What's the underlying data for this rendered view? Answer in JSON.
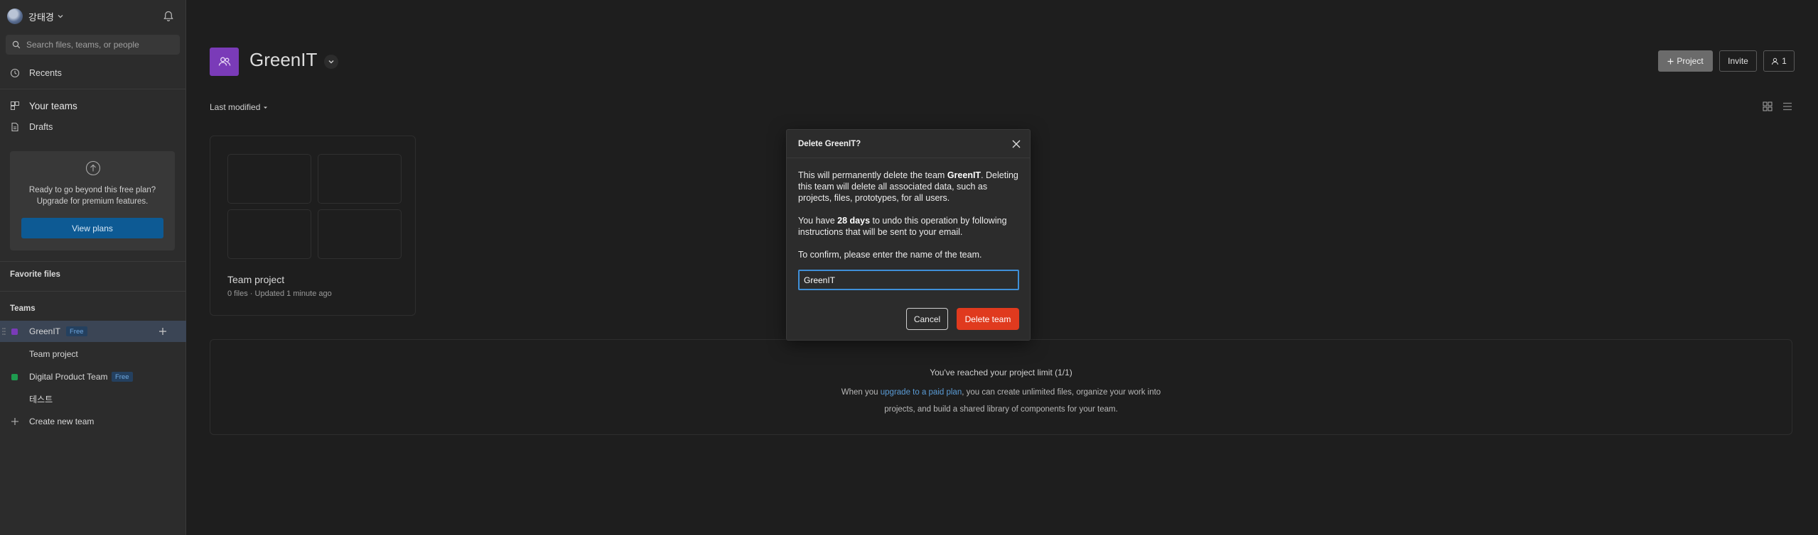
{
  "sidebar": {
    "user_name": "강태경",
    "search_placeholder": "Search files, teams, or people",
    "recents_label": "Recents",
    "your_teams_label": "Your teams",
    "drafts_label": "Drafts",
    "upgrade": {
      "line1": "Ready to go beyond this free plan?",
      "line2": "Upgrade for premium features.",
      "button": "View plans"
    },
    "favorite_files_label": "Favorite files",
    "teams_label": "Teams",
    "teams": [
      {
        "name": "GreenIT",
        "badge": "Free",
        "color": "#7a3bb8"
      },
      {
        "name": "Team project"
      },
      {
        "name": "Digital Product Team",
        "badge": "Free",
        "color": "#1e9b4f"
      },
      {
        "name": "테스트"
      }
    ],
    "create_team_label": "Create new team"
  },
  "main": {
    "team_title": "GreenIT",
    "project_button": "Project",
    "invite_button": "Invite",
    "members_count": "1",
    "sort_label": "Last modified",
    "project_card": {
      "title": "Team project",
      "meta": "0 files · Updated 1 minute ago"
    },
    "limit": {
      "title": "You've reached your project limit (1/1)",
      "text_before": "When you ",
      "link": "upgrade to a paid plan",
      "text_after": ", you can create unlimited files, organize your work into",
      "line2": "projects, and build a shared library of components for your team."
    }
  },
  "modal": {
    "title": "Delete GreenIT?",
    "p1_before": "This will permanently delete the team ",
    "p1_team": "GreenIT",
    "p1_after": ". Deleting this team will delete all associated data, such as projects, files, prototypes, for all users.",
    "p2_before": "You have ",
    "p2_days": "28 days",
    "p2_after": " to undo this operation by following instructions that will be sent to your email.",
    "p3": "To confirm, please enter the name of the team.",
    "input_value": "GreenIT",
    "cancel_button": "Cancel",
    "delete_button": "Delete team"
  },
  "colors": {
    "accent_purple": "#7a3bb8",
    "danger": "#e03a1e",
    "focus_blue": "#3f8fd8",
    "link_blue": "#5a9bd5",
    "plan_button": "#0d5a94"
  }
}
